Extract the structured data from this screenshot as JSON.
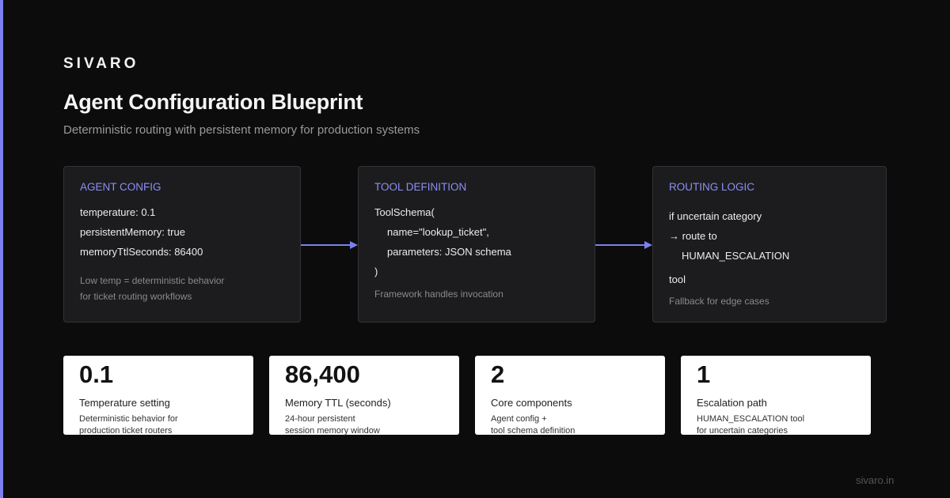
{
  "brand": "SIVARO",
  "title": "Agent Configuration Blueprint",
  "subtitle": "Deterministic routing with persistent memory for production systems",
  "colors": {
    "accent": "#7b7ff0",
    "card_heading": "#8b8ff5",
    "background": "#0c0c0c"
  },
  "cards": [
    {
      "heading": "AGENT CONFIG",
      "lines": [
        "temperature: 0.1",
        "persistentMemory: true",
        "memoryTtlSeconds: 86400"
      ],
      "note": [
        "Low temp = deterministic behavior",
        "for ticket routing workflows"
      ]
    },
    {
      "heading": "TOOL DEFINITION",
      "lines": [
        "ToolSchema(",
        "name=\"lookup_ticket\",",
        "parameters: JSON schema",
        ")"
      ],
      "note": [
        "Framework handles invocation"
      ]
    },
    {
      "heading": "ROUTING LOGIC",
      "lines": [
        "if uncertain category",
        "→ route to",
        "HUMAN_ESCALATION",
        "tool"
      ],
      "note": [
        "Fallback for edge cases"
      ]
    }
  ],
  "stats": [
    {
      "value": "0.1",
      "label": "Temperature setting",
      "desc": [
        "Deterministic behavior for",
        "production ticket routers"
      ]
    },
    {
      "value": "86,400",
      "label": "Memory TTL (seconds)",
      "desc": [
        "24-hour persistent",
        "session memory window"
      ]
    },
    {
      "value": "2",
      "label": "Core components",
      "desc": [
        "Agent config +",
        "tool schema definition"
      ]
    },
    {
      "value": "1",
      "label": "Escalation path",
      "desc": [
        "HUMAN_ESCALATION tool",
        "for uncertain categories"
      ]
    }
  ],
  "footer": "sivaro.in"
}
